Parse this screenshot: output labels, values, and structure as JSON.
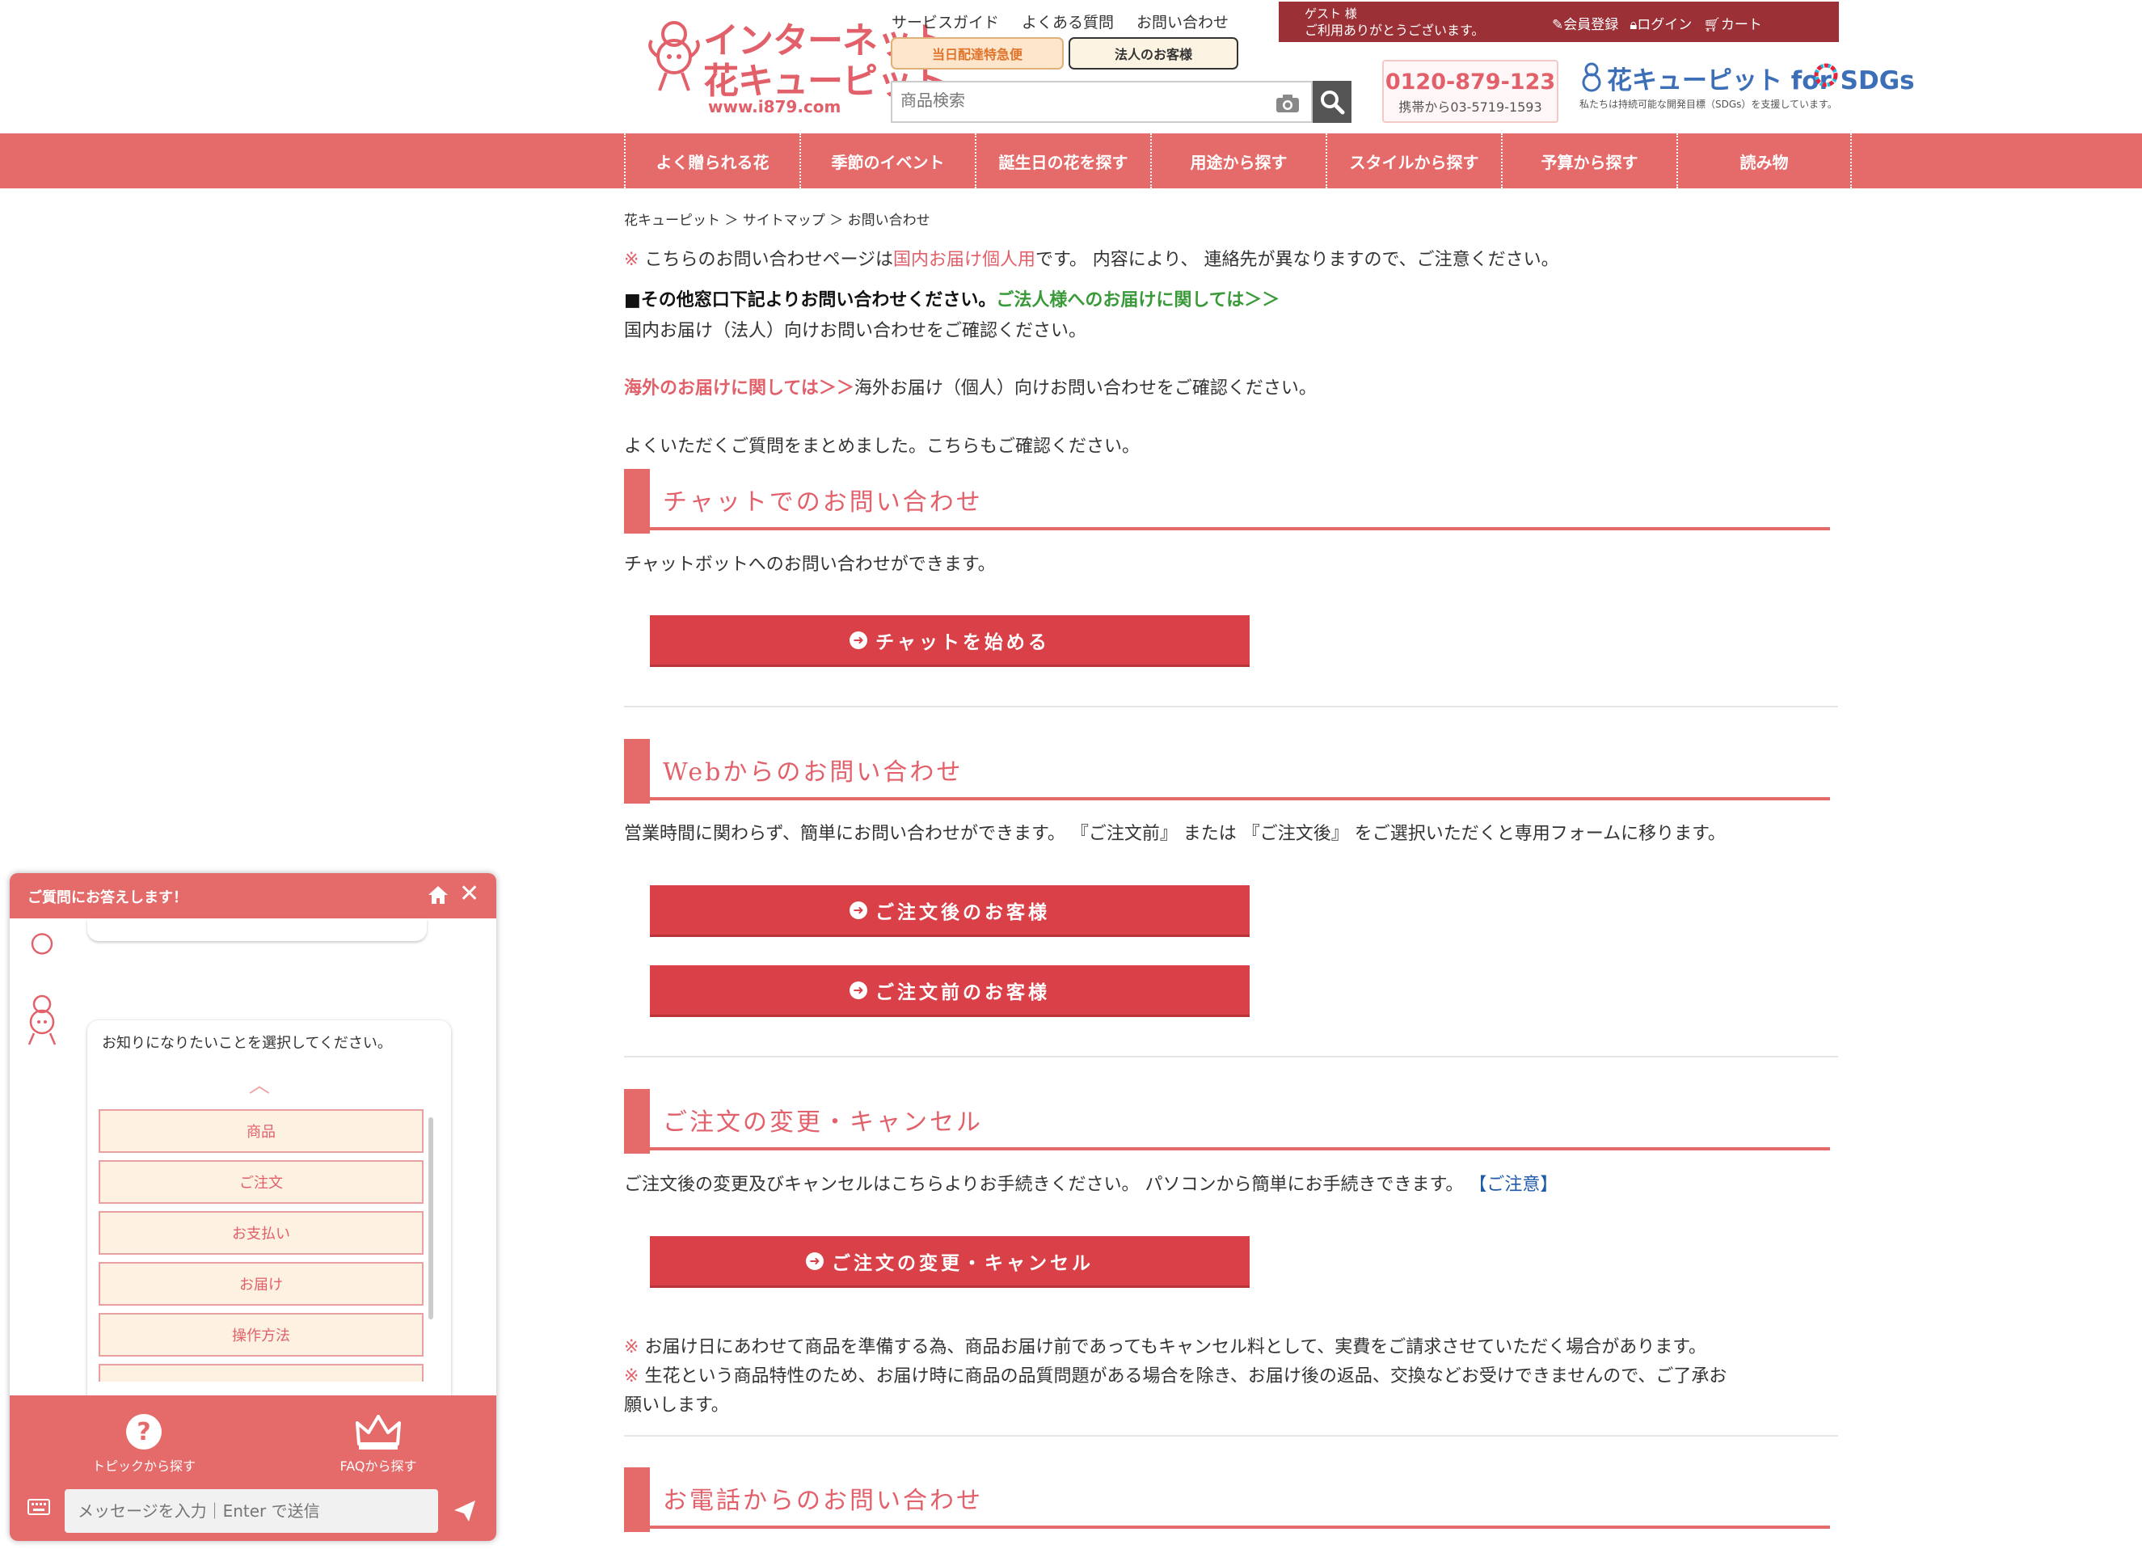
{
  "header": {
    "logo_line1": "インターネット",
    "logo_line2": "花キューピット",
    "logo_url": "www.i879.com",
    "top_links": [
      "サービスガイド",
      "よくある質問",
      "お問い合わせ"
    ],
    "same_day_label": "当日配達特急便",
    "corporate_label": "法人のお客様",
    "search_placeholder": "商品検索",
    "guest_name": "ゲスト 様",
    "guest_message": "ご利用ありがとうございます。",
    "register_label": "会員登録",
    "login_label": "ログイン",
    "cart_label": "カート",
    "phone_number": "0120-879-123",
    "phone_mobile": "携帯から03-5719-1593",
    "sdgs_title": "花キューピット for SDGs",
    "sdgs_sub": "私たちは持続可能な開発目標（SDGs）を支援しています。"
  },
  "nav": {
    "items": [
      "よく贈られる花",
      "季節のイベント",
      "誕生日の花を探す",
      "用途から探す",
      "スタイルから探す",
      "予算から探す",
      "読み物"
    ]
  },
  "breadcrumb": "花キューピット ＞ サイトマップ ＞ お問い合わせ",
  "intro": {
    "mark": "※",
    "line1_a": "こちらのお問い合わせページは",
    "line1_b": "国内お届け個人用",
    "line1_c": "です。 内容により、 連絡先が異なりますので、ご注意ください。",
    "line2_a": "■その他窓口下記よりお問い合わせください。",
    "line2_b": "ご法人様へのお届けに関しては＞＞",
    "line3": "国内お届け（法人）向けお問い合わせをご確認ください。",
    "line4_a": "海外のお届けに関しては＞＞",
    "line4_b": "海外お届け（個人）向けお問い合わせをご確認ください。",
    "line5": "よくいただくご質問をまとめました。こちらもご確認ください。"
  },
  "chat_section": {
    "title": "チャットでのお問い合わせ",
    "desc": "チャットボットへのお問い合わせができます。",
    "button": "チャットを始める"
  },
  "web_section": {
    "title": "Webからのお問い合わせ",
    "desc": "営業時間に関わらず、簡単にお問い合わせができます。 『ご注文前』 または 『ご注文後』 をご選択いただくと専用フォームに移ります。",
    "button_after": "ご注文後のお客様",
    "button_before": "ご注文前のお客様"
  },
  "change_section": {
    "title": "ご注文の変更・キャンセル",
    "desc": "ご注文後の変更及びキャンセルはこちらよりお手続きください。 パソコンから簡単にお手続きできます。",
    "notice_link": "【ご注意】",
    "button": "ご注文の変更・キャンセル",
    "note1": "お届け日にあわせて商品を準備する為、商品お届け前であってもキャンセル料として、実費をご請求させていただく場合があります。",
    "note2": "生花という商品特性のため、お届け時に商品の品質問題がある場合を除き、お届け後の返品、交換などお受けできませんので、ご了承お",
    "note3": "願いします。"
  },
  "phone_section": {
    "title": "お電話からのお問い合わせ"
  },
  "chatbot": {
    "header": "ご質問にお答えします！",
    "prompt": "お知りになりたいことを選択してください。",
    "choices": [
      "商品",
      "ご注文",
      "お支払い",
      "お届け",
      "操作方法"
    ],
    "topic_label": "トピックから探す",
    "faq_label": "FAQから探す",
    "input_placeholder": "メッセージを入力｜Enter で送信"
  },
  "colors": {
    "accent": "#e56a6a",
    "button": "#d94047",
    "dark_red": "#9b3036"
  }
}
